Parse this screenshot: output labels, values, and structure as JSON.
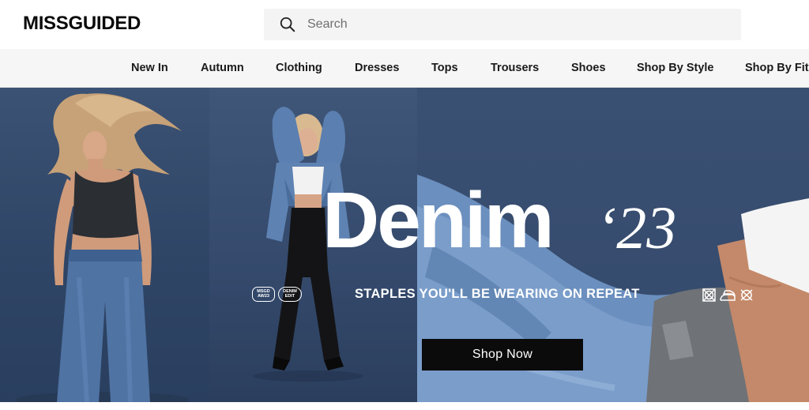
{
  "header": {
    "logo": "MISSGUIDED",
    "search": {
      "placeholder": "Search",
      "icon": "search-icon"
    }
  },
  "nav": {
    "items": [
      {
        "label": "New In"
      },
      {
        "label": "Autumn"
      },
      {
        "label": "Clothing"
      },
      {
        "label": "Dresses"
      },
      {
        "label": "Tops"
      },
      {
        "label": "Trousers"
      },
      {
        "label": "Shoes"
      },
      {
        "label": "Shop By Style"
      },
      {
        "label": "Shop By Fit"
      }
    ]
  },
  "hero": {
    "title": "Denim",
    "year": "‘23",
    "subtitle": "STAPLES YOU'LL BE WEARING ON REPEAT",
    "badges": [
      "MSGD AW23",
      "DENIM EDIT"
    ],
    "cta_label": "Shop Now",
    "colors": {
      "background": "#34496a",
      "denim": "#5b7fb0",
      "cta": "#0b0b0b"
    }
  }
}
